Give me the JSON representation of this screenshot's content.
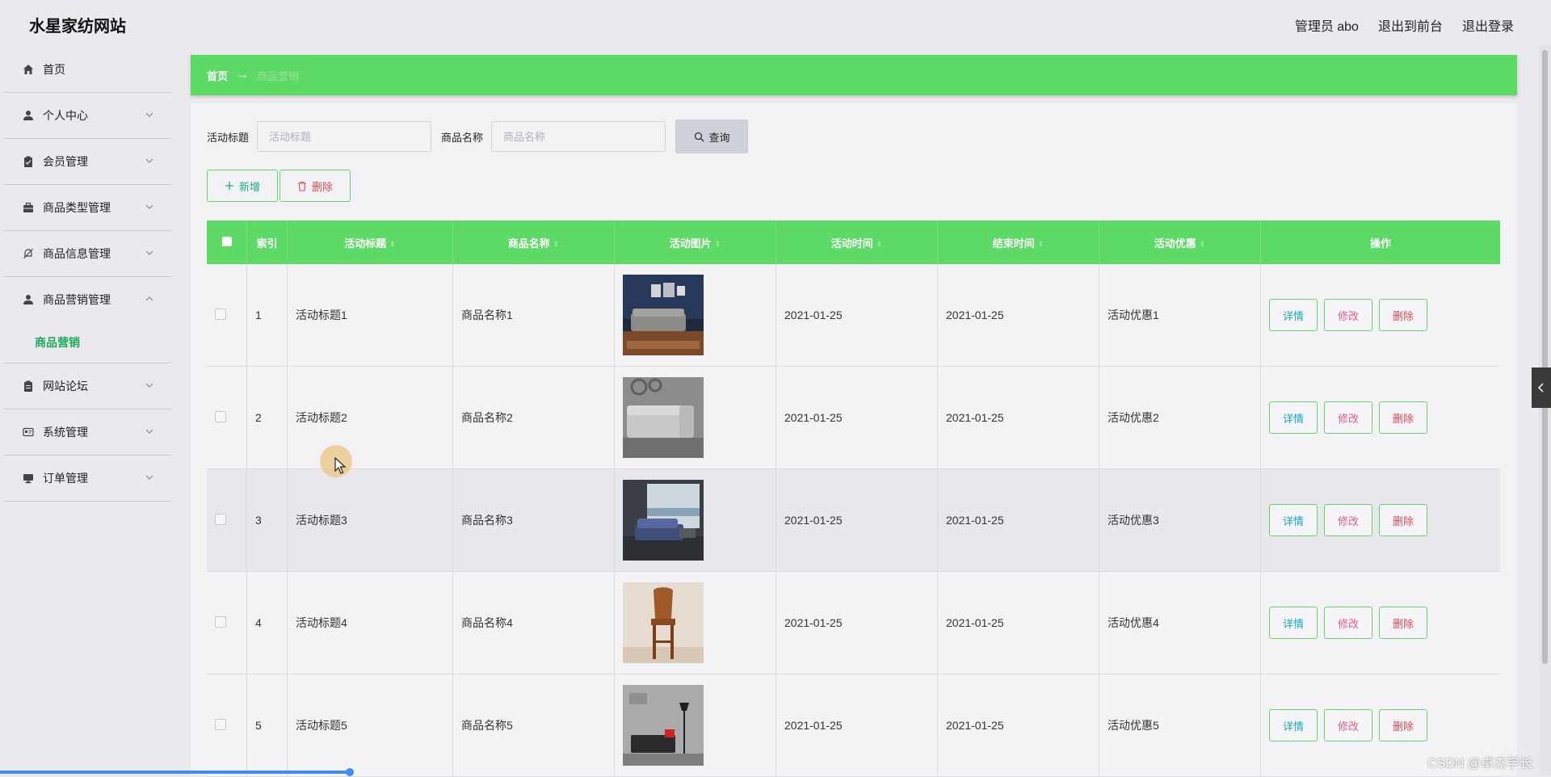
{
  "header": {
    "brand": "水星家纺网站",
    "admin_label": "管理员 abo",
    "front_link": "退出到前台",
    "logout_link": "退出登录"
  },
  "sidebar": {
    "items": [
      {
        "label": "首页",
        "icon": "home-icon"
      },
      {
        "label": "个人中心",
        "icon": "user-icon"
      },
      {
        "label": "会员管理",
        "icon": "clipboard-icon"
      },
      {
        "label": "商品类型管理",
        "icon": "briefcase-icon"
      },
      {
        "label": "商品信息管理",
        "icon": "bell-off-icon"
      },
      {
        "label": "商品营销管理",
        "icon": "user-icon"
      },
      {
        "label": "网站论坛",
        "icon": "clipboard-icon"
      },
      {
        "label": "系统管理",
        "icon": "id-card-icon"
      },
      {
        "label": "订单管理",
        "icon": "monitor-icon"
      }
    ],
    "submenu_active": "商品营销"
  },
  "breadcrumb": {
    "home": "首页",
    "arrow": "→",
    "current": "商品营销"
  },
  "search": {
    "title_label": "活动标题",
    "title_placeholder": "活动标题",
    "name_label": "商品名称",
    "name_placeholder": "商品名称",
    "query_label": "查询"
  },
  "actions": {
    "add_label": "新增",
    "delete_label": "删除"
  },
  "table": {
    "columns": [
      "索引",
      "活动标题",
      "商品名称",
      "活动图片",
      "活动时间",
      "结束时间",
      "活动优惠",
      "操作"
    ],
    "rows": [
      {
        "index": "1",
        "title": "活动标题1",
        "product": "商品名称1",
        "image": "sofa-dark-room-photo",
        "start": "2021-01-25",
        "end": "2021-01-25",
        "discount": "活动优惠1"
      },
      {
        "index": "2",
        "title": "活动标题2",
        "product": "商品名称2",
        "image": "grey-sectional-sofa-photo",
        "start": "2021-01-25",
        "end": "2021-01-25",
        "discount": "活动优惠2"
      },
      {
        "index": "3",
        "title": "活动标题3",
        "product": "商品名称3",
        "image": "blue-sofa-window-photo",
        "start": "2021-01-25",
        "end": "2021-01-25",
        "discount": "活动优惠3"
      },
      {
        "index": "4",
        "title": "活动标题4",
        "product": "商品名称4",
        "image": "wooden-chair-photo",
        "start": "2021-01-25",
        "end": "2021-01-25",
        "discount": "活动优惠4"
      },
      {
        "index": "5",
        "title": "活动标题5",
        "product": "商品名称5",
        "image": "red-sofa-grey-wall-photo",
        "start": "2021-01-25",
        "end": "2021-01-25",
        "discount": "活动优惠5"
      }
    ],
    "row_actions": {
      "detail": "详情",
      "edit": "修改",
      "delete": "删除"
    }
  },
  "watermark": "CSDN @卓杰学长",
  "colors": {
    "accent_green": "#5dd965",
    "detail_text": "#17a6c6",
    "edit_text": "#e85a8c",
    "delete_text": "#e04b55",
    "active_submenu": "#1aaa5a"
  }
}
